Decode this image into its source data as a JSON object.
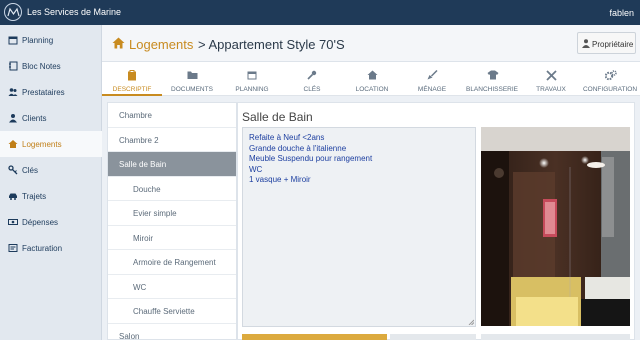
{
  "app": {
    "title": "Les Services de Marine",
    "user": "fablen"
  },
  "sidebar": {
    "items": [
      {
        "label": "Planning",
        "icon": "calendar-icon"
      },
      {
        "label": "Bloc Notes",
        "icon": "notebook-icon"
      },
      {
        "label": "Prestataires",
        "icon": "people-icon"
      },
      {
        "label": "Clients",
        "icon": "user-icon"
      },
      {
        "label": "Logements",
        "icon": "home-icon"
      },
      {
        "label": "Clés",
        "icon": "key-icon"
      },
      {
        "label": "Trajets",
        "icon": "car-icon"
      },
      {
        "label": "Dépenses",
        "icon": "money-icon"
      },
      {
        "label": "Facturation",
        "icon": "invoice-icon"
      }
    ],
    "active": "Logements",
    "accent": "#c07f18"
  },
  "header": {
    "breadcrumb_link": "Logements",
    "breadcrumb_rest": "> Appartement Style 70'S",
    "owner_button": "Propriétaire"
  },
  "tabs": [
    {
      "label": "DESCRIPTIF",
      "icon": "clipboard-icon",
      "active": true
    },
    {
      "label": "DOCUMENTS",
      "icon": "folder-icon"
    },
    {
      "label": "PLANNING",
      "icon": "calendar-icon"
    },
    {
      "label": "CLÉS",
      "icon": "key-icon"
    },
    {
      "label": "LOCATION",
      "icon": "home-icon"
    },
    {
      "label": "MÉNAGE",
      "icon": "broom-icon"
    },
    {
      "label": "BLANCHISSERIE",
      "icon": "tshirt-icon"
    },
    {
      "label": "TRAVAUX",
      "icon": "tools-icon"
    },
    {
      "label": "CONFIGURATION",
      "icon": "cogs-icon"
    }
  ],
  "rooms": [
    {
      "label": "Chambre",
      "sub": false
    },
    {
      "label": "Chambre 2",
      "sub": false
    },
    {
      "label": "Salle de Bain",
      "sub": false,
      "active": true
    },
    {
      "label": "Douche",
      "sub": true
    },
    {
      "label": "Evier simple",
      "sub": true
    },
    {
      "label": "Miroir",
      "sub": true
    },
    {
      "label": "Armoire de Rangement",
      "sub": true
    },
    {
      "label": "WC",
      "sub": true
    },
    {
      "label": "Chauffe Serviette",
      "sub": true
    },
    {
      "label": "Salon",
      "sub": false
    }
  ],
  "detail": {
    "title": "Salle de Bain",
    "description": [
      "Refaite à Neuf <2ans",
      "Grande douche à l'italienne",
      "Meuble Suspendu pour rangement",
      "WC",
      "1 vasque + Miroir"
    ]
  },
  "colors": {
    "topbar": "#1f3a58",
    "accent": "#c88b20",
    "link": "#1d3fa0"
  }
}
